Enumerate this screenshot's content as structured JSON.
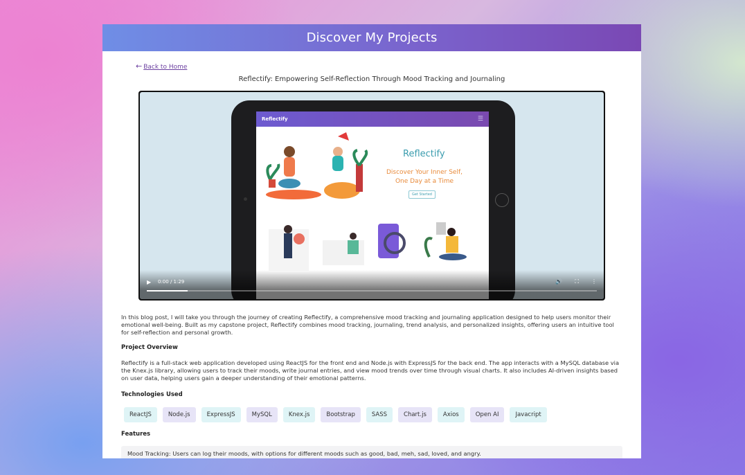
{
  "header": {
    "title": "Discover My Projects"
  },
  "nav": {
    "back_label": "Back to Home",
    "back_arrow": "←"
  },
  "post": {
    "title": "Reflectify: Empowering Self-Reflection Through Mood Tracking and Journaling"
  },
  "video": {
    "time": "0:00 / 1:29",
    "progress": 0.09,
    "screen": {
      "logo": "Reflectify",
      "hero_title": "Reflectify",
      "hero_subtitle": "Discover Your Inner Self, One Day at a Time",
      "hero_button": "Get Started"
    }
  },
  "content": {
    "intro": "In this blog post, I will take you through the journey of creating Reflectify, a comprehensive mood tracking and journaling application designed to help users monitor their emotional well-being. Built as my capstone project, Reflectify combines mood tracking, journaling, trend analysis, and personalized insights, offering users an intuitive tool for self-reflection and personal growth.",
    "overview_heading": "Project Overview",
    "overview": "Reflectify is a full-stack web application developed using ReactJS for the front end and Node.js with ExpressJS for the back end. The app interacts with a MySQL database via the Knex.js library, allowing users to track their moods, write journal entries, and view mood trends over time through visual charts. It also includes AI-driven insights based on user data, helping users gain a deeper understanding of their emotional patterns.",
    "tech_heading": "Technologies Used",
    "technologies": [
      "ReactJS",
      "Node.js",
      "ExpressJS",
      "MySQL",
      "Knex.js",
      "Bootstrap",
      "SASS",
      "Chart.js",
      "Axios",
      "Open AI",
      "Javacript"
    ],
    "features_heading": "Features",
    "features": [
      "Mood Tracking: Users can log their moods, with options for different moods such as good, bad, meh, sad, loved, and angry."
    ]
  }
}
